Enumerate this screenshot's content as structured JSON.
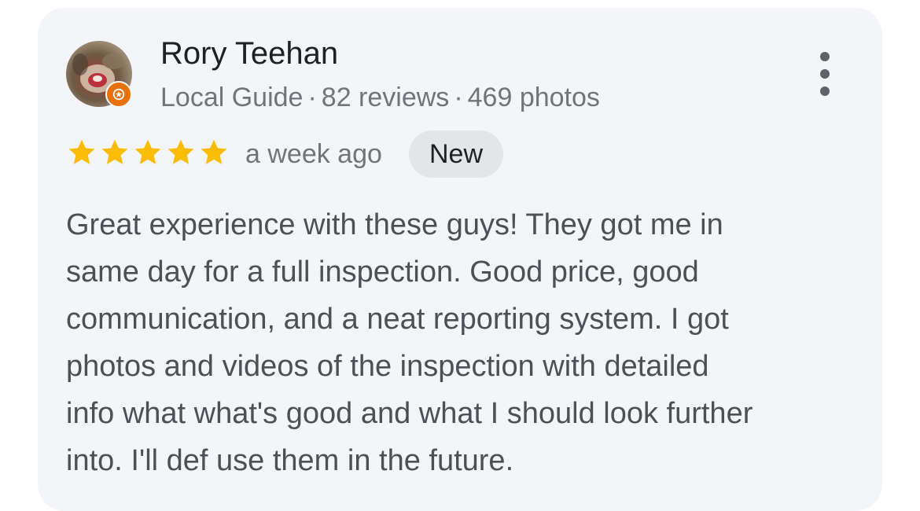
{
  "reviewer": {
    "name": "Rory Teehan",
    "badge": "Local Guide",
    "reviews": "82 reviews",
    "photos": "469 photos",
    "separator": "·"
  },
  "rating": {
    "stars": 5,
    "max": 5,
    "star_color": "#fbbc04",
    "date": "a week ago",
    "new_label": "New"
  },
  "review": {
    "lines": [
      "Great experience with these guys! They got me in",
      "same day for a full inspection. Good price, good",
      "communication, and a neat reporting system. I got",
      "photos and videos of the inspection with detailed",
      "info what what's good and what I should look further",
      "into. I'll def use them in the future."
    ]
  },
  "icons": {
    "avatar": "profile-photo",
    "guide": "local-guide-star-icon",
    "more": "more-vert-icon",
    "star": "star-icon"
  },
  "colors": {
    "card_bg": "#f4f5f8",
    "guide_badge": "#e8710a",
    "badge_bg": "#e3e5e8"
  }
}
